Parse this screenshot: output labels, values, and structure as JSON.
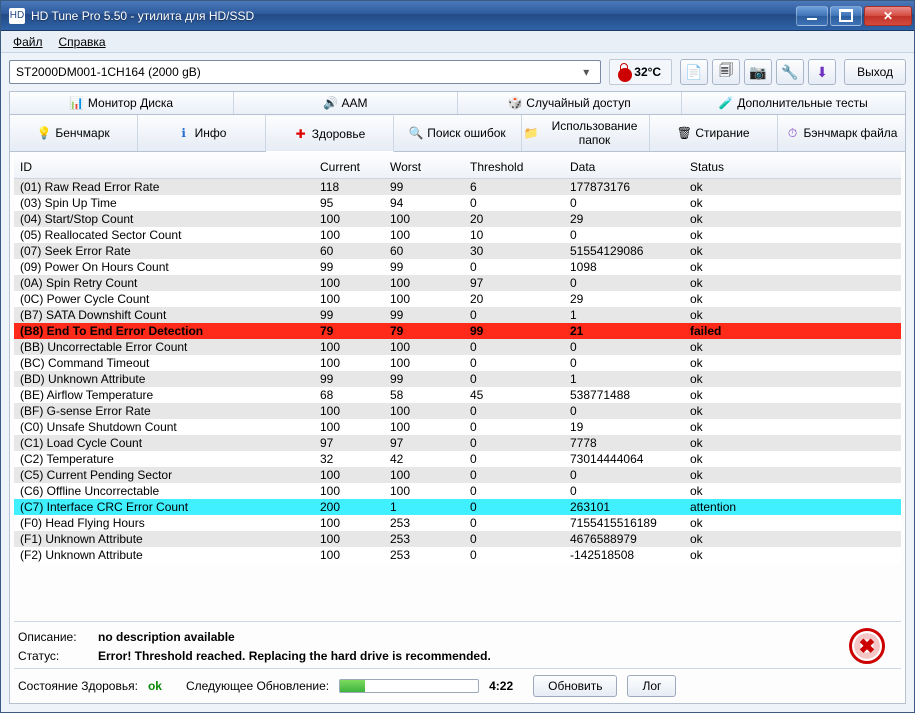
{
  "window": {
    "title": "HD Tune Pro 5.50 - утилита для HD/SSD"
  },
  "menu": {
    "file": "Файл",
    "help": "Справка"
  },
  "toolbar": {
    "drive": "ST2000DM001-1CH164 (2000 gB)",
    "temperature": "32°C",
    "exit": "Выход"
  },
  "tabs_row1": {
    "monitor": "Монитор Диска",
    "aam": "AAM",
    "random": "Случайный доступ",
    "extra": "Дополнительные тесты"
  },
  "tabs_row2": {
    "benchmark": "Бенчмарк",
    "info": "Инфо",
    "health": "Здоровье",
    "scan": "Поиск ошибок",
    "folders": "Использование папок",
    "erase": "Стирание",
    "filebench": "Бэнчмарк файла"
  },
  "columns": {
    "id": "ID",
    "current": "Current",
    "worst": "Worst",
    "threshold": "Threshold",
    "data": "Data",
    "status": "Status"
  },
  "rows": [
    {
      "id": "(01) Raw Read Error Rate",
      "current": "118",
      "worst": "99",
      "threshold": "6",
      "data": "177873176",
      "status": "ok",
      "state": "normal"
    },
    {
      "id": "(03) Spin Up Time",
      "current": "95",
      "worst": "94",
      "threshold": "0",
      "data": "0",
      "status": "ok",
      "state": "normal"
    },
    {
      "id": "(04) Start/Stop Count",
      "current": "100",
      "worst": "100",
      "threshold": "20",
      "data": "29",
      "status": "ok",
      "state": "normal"
    },
    {
      "id": "(05) Reallocated Sector Count",
      "current": "100",
      "worst": "100",
      "threshold": "10",
      "data": "0",
      "status": "ok",
      "state": "normal"
    },
    {
      "id": "(07) Seek Error Rate",
      "current": "60",
      "worst": "60",
      "threshold": "30",
      "data": "51554129086",
      "status": "ok",
      "state": "normal"
    },
    {
      "id": "(09) Power On Hours Count",
      "current": "99",
      "worst": "99",
      "threshold": "0",
      "data": "1098",
      "status": "ok",
      "state": "normal"
    },
    {
      "id": "(0A) Spin Retry Count",
      "current": "100",
      "worst": "100",
      "threshold": "97",
      "data": "0",
      "status": "ok",
      "state": "normal"
    },
    {
      "id": "(0C) Power Cycle Count",
      "current": "100",
      "worst": "100",
      "threshold": "20",
      "data": "29",
      "status": "ok",
      "state": "normal"
    },
    {
      "id": "(B7) SATA Downshift Count",
      "current": "99",
      "worst": "99",
      "threshold": "0",
      "data": "1",
      "status": "ok",
      "state": "normal"
    },
    {
      "id": "(B8) End To End Error Detection",
      "current": "79",
      "worst": "79",
      "threshold": "99",
      "data": "21",
      "status": "failed",
      "state": "failed"
    },
    {
      "id": "(BB) Uncorrectable Error Count",
      "current": "100",
      "worst": "100",
      "threshold": "0",
      "data": "0",
      "status": "ok",
      "state": "normal"
    },
    {
      "id": "(BC) Command Timeout",
      "current": "100",
      "worst": "100",
      "threshold": "0",
      "data": "0",
      "status": "ok",
      "state": "normal"
    },
    {
      "id": "(BD) Unknown Attribute",
      "current": "99",
      "worst": "99",
      "threshold": "0",
      "data": "1",
      "status": "ok",
      "state": "normal"
    },
    {
      "id": "(BE) Airflow Temperature",
      "current": "68",
      "worst": "58",
      "threshold": "45",
      "data": "538771488",
      "status": "ok",
      "state": "normal"
    },
    {
      "id": "(BF) G-sense Error Rate",
      "current": "100",
      "worst": "100",
      "threshold": "0",
      "data": "0",
      "status": "ok",
      "state": "normal"
    },
    {
      "id": "(C0) Unsafe Shutdown Count",
      "current": "100",
      "worst": "100",
      "threshold": "0",
      "data": "19",
      "status": "ok",
      "state": "normal"
    },
    {
      "id": "(C1) Load Cycle Count",
      "current": "97",
      "worst": "97",
      "threshold": "0",
      "data": "7778",
      "status": "ok",
      "state": "normal"
    },
    {
      "id": "(C2) Temperature",
      "current": "32",
      "worst": "42",
      "threshold": "0",
      "data": "73014444064",
      "status": "ok",
      "state": "normal"
    },
    {
      "id": "(C5) Current Pending Sector",
      "current": "100",
      "worst": "100",
      "threshold": "0",
      "data": "0",
      "status": "ok",
      "state": "normal"
    },
    {
      "id": "(C6) Offline Uncorrectable",
      "current": "100",
      "worst": "100",
      "threshold": "0",
      "data": "0",
      "status": "ok",
      "state": "normal"
    },
    {
      "id": "(C7) Interface CRC Error Count",
      "current": "200",
      "worst": "1",
      "threshold": "0",
      "data": "263101",
      "status": "attention",
      "state": "attention"
    },
    {
      "id": "(F0) Head Flying Hours",
      "current": "100",
      "worst": "253",
      "threshold": "0",
      "data": "7155415516189",
      "status": "ok",
      "state": "normal"
    },
    {
      "id": "(F1) Unknown Attribute",
      "current": "100",
      "worst": "253",
      "threshold": "0",
      "data": "4676588979",
      "status": "ok",
      "state": "normal"
    },
    {
      "id": "(F2) Unknown Attribute",
      "current": "100",
      "worst": "253",
      "threshold": "0",
      "data": "-142518508",
      "status": "ok",
      "state": "normal"
    }
  ],
  "description": {
    "desc_label": "Описание:",
    "desc_value": "no description available",
    "status_label": "Статус:",
    "status_value": "Error! Threshold reached. Replacing the hard drive is recommended."
  },
  "footer": {
    "health_label": "Состояние Здоровья:",
    "health_value": "ok",
    "next_label": "Следующее Обновление:",
    "next_time": "4:22",
    "refresh": "Обновить",
    "log": "Лог"
  }
}
